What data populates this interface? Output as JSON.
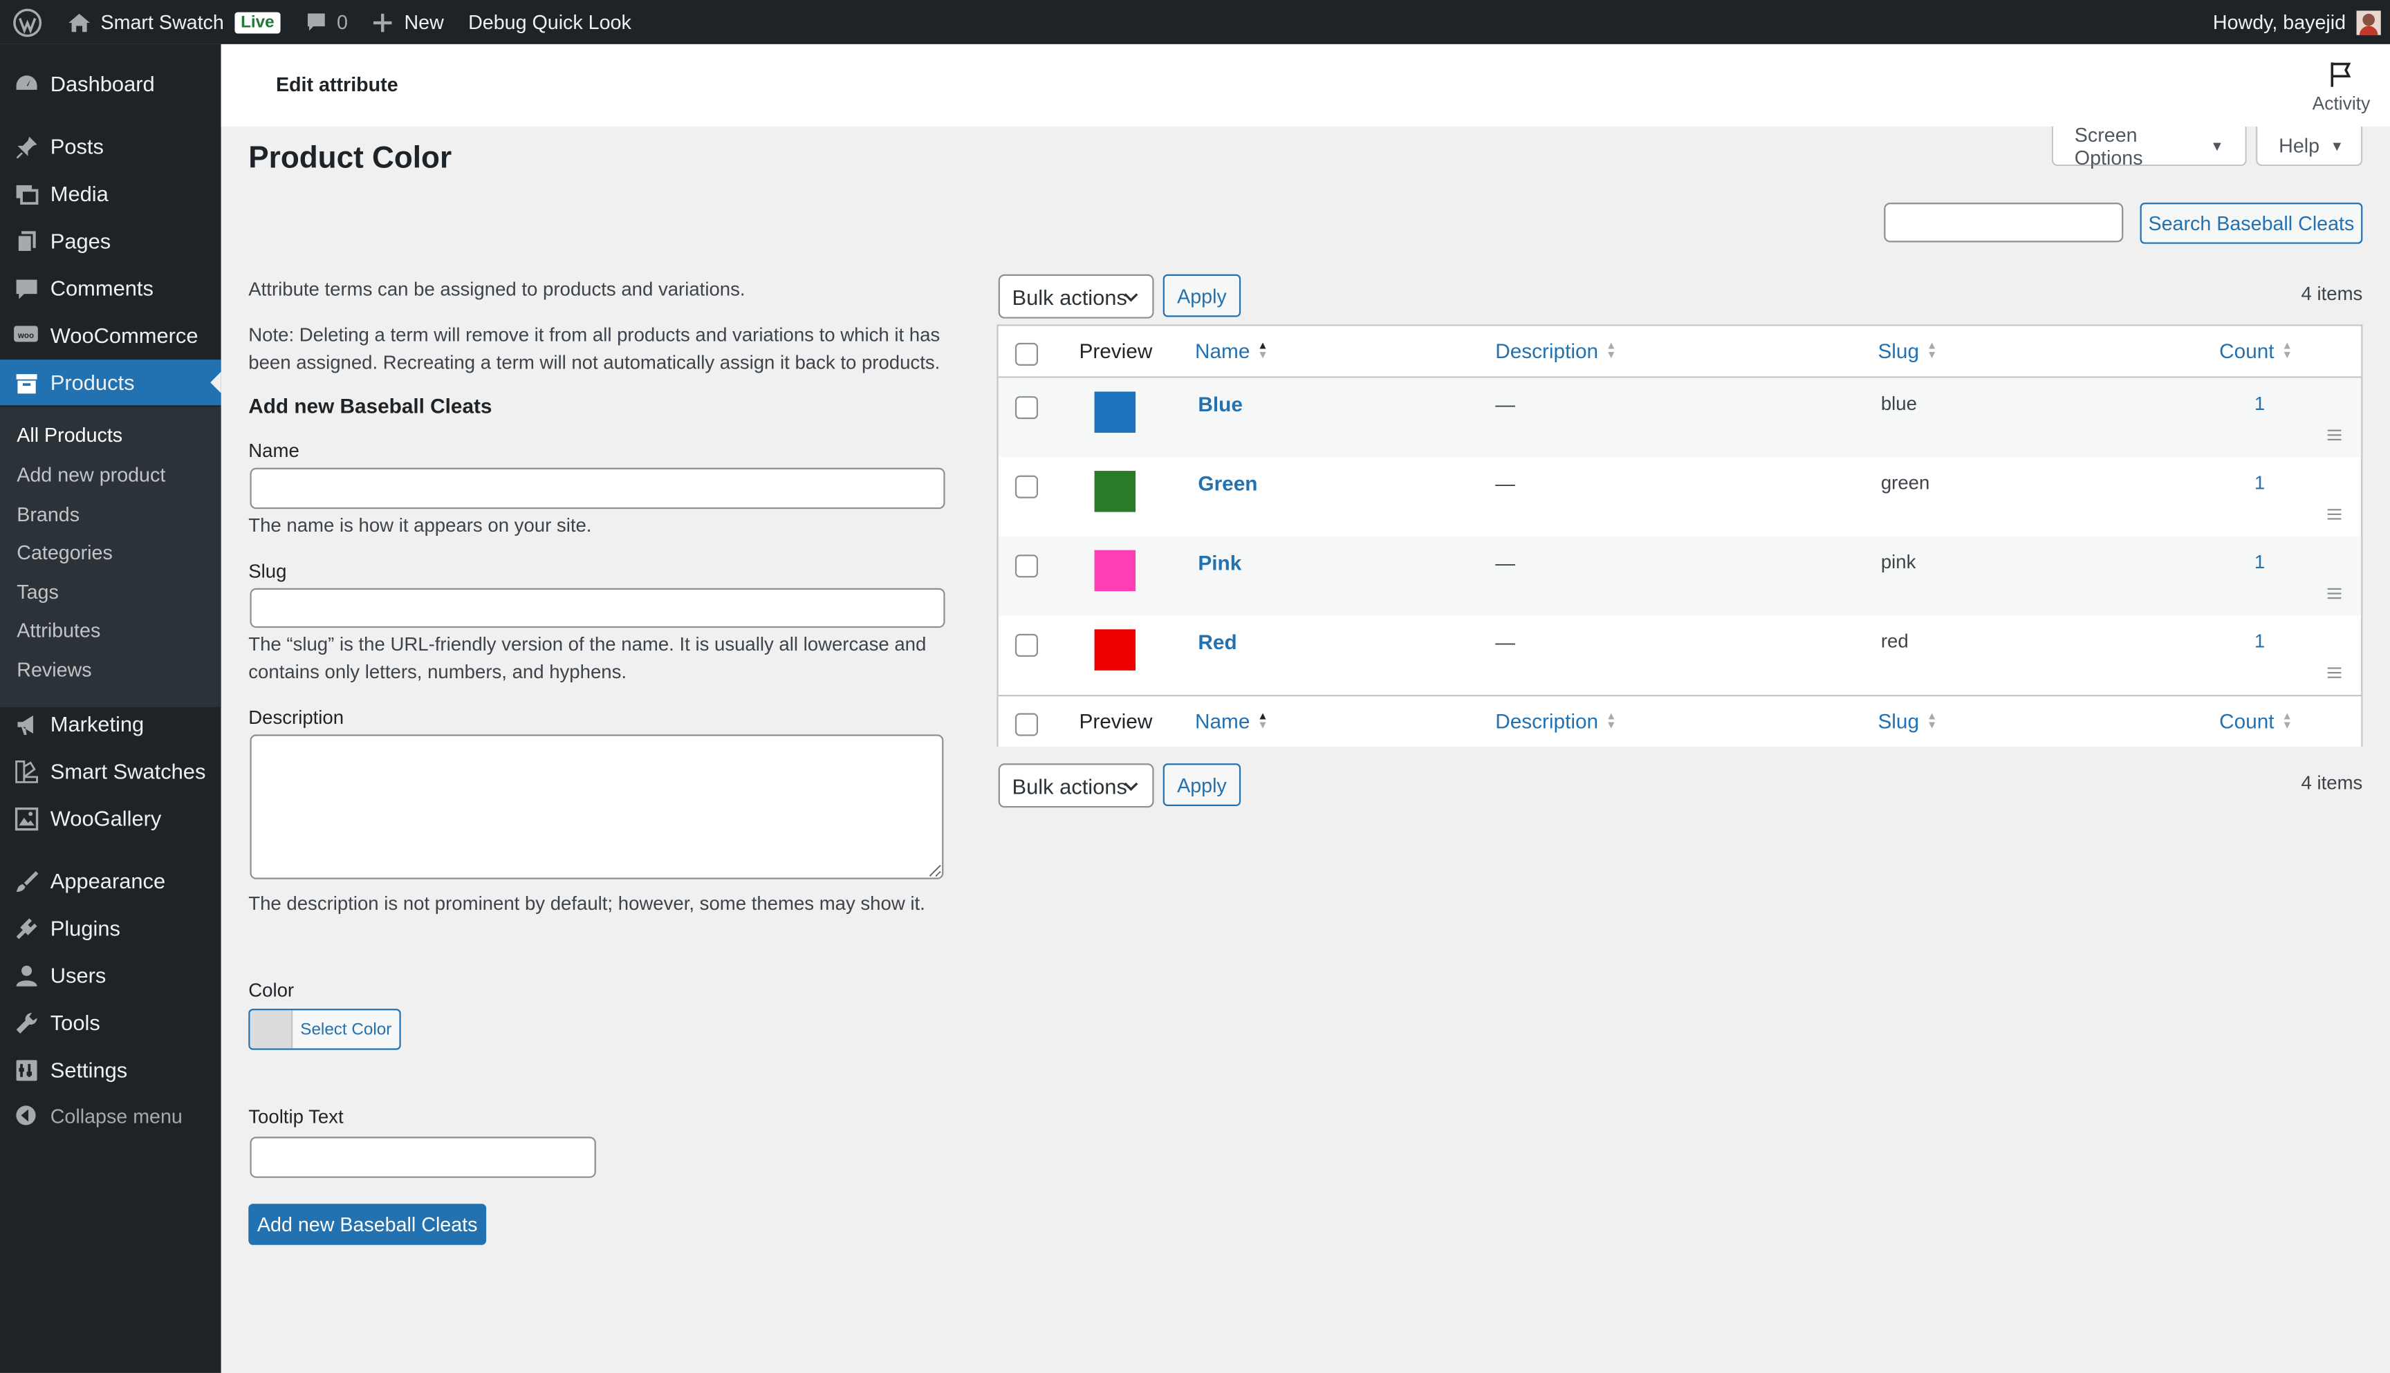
{
  "adminbar": {
    "site_name": "Smart Swatch",
    "live_badge": "Live",
    "comment_count": "0",
    "new_label": "New",
    "debug_label": "Debug Quick Look",
    "howdy": "Howdy, bayejid"
  },
  "sidebar": {
    "items": [
      {
        "label": "Dashboard",
        "icon": "dashboard-icon"
      },
      {
        "label": "Posts",
        "icon": "pin-icon"
      },
      {
        "label": "Media",
        "icon": "media-icon"
      },
      {
        "label": "Pages",
        "icon": "pages-icon"
      },
      {
        "label": "Comments",
        "icon": "comment-icon"
      },
      {
        "label": "WooCommerce",
        "icon": "woo-icon"
      },
      {
        "label": "Products",
        "icon": "archive-icon",
        "active": true
      },
      {
        "label": "Marketing",
        "icon": "megaphone-icon"
      },
      {
        "label": "Smart Swatches",
        "icon": "swatches-icon"
      },
      {
        "label": "WooGallery",
        "icon": "gallery-icon"
      },
      {
        "label": "Appearance",
        "icon": "brush-icon"
      },
      {
        "label": "Plugins",
        "icon": "plugin-icon"
      },
      {
        "label": "Users",
        "icon": "user-icon"
      },
      {
        "label": "Tools",
        "icon": "wrench-icon"
      },
      {
        "label": "Settings",
        "icon": "settings-icon"
      }
    ],
    "submenu": [
      "All Products",
      "Add new product",
      "Brands",
      "Categories",
      "Tags",
      "Attributes",
      "Reviews"
    ],
    "collapse_label": "Collapse menu"
  },
  "header": {
    "title": "Edit attribute",
    "activity_label": "Activity",
    "screen_options": "Screen Options",
    "help": "Help"
  },
  "page": {
    "title": "Product Color",
    "search_button": "Search Baseball Cleats"
  },
  "form": {
    "intro": "Attribute terms can be assigned to products and variations.",
    "note_line1": "Note: Deleting a term will remove it from all products and variations to which it has",
    "note_line2": "been assigned. Recreating a term will not automatically assign it back to products.",
    "heading": "Add new Baseball Cleats",
    "name_label": "Name",
    "name_help": "The name is how it appears on your site.",
    "slug_label": "Slug",
    "slug_help_line1": "The “slug” is the URL-friendly version of the name. It is usually all lowercase and",
    "slug_help_line2": "contains only letters, numbers, and hyphens.",
    "description_label": "Description",
    "description_help": "The description is not prominent by default; however, some themes may show it.",
    "color_label": "Color",
    "select_color": "Select Color",
    "tooltip_label": "Tooltip Text",
    "submit": "Add new Baseball Cleats"
  },
  "table": {
    "bulk_actions": "Bulk actions",
    "apply": "Apply",
    "items_count": "4 items",
    "columns": {
      "preview": "Preview",
      "name": "Name",
      "description": "Description",
      "slug": "Slug",
      "count": "Count"
    },
    "rows": [
      {
        "name": "Blue",
        "description": "—",
        "slug": "blue",
        "count": "1",
        "color": "#1e73be"
      },
      {
        "name": "Green",
        "description": "—",
        "slug": "green",
        "count": "1",
        "color": "#2a7a2a"
      },
      {
        "name": "Pink",
        "description": "—",
        "slug": "pink",
        "count": "1",
        "color": "#ff3fb4"
      },
      {
        "name": "Red",
        "description": "—",
        "slug": "red",
        "count": "1",
        "color": "#ee0000"
      }
    ]
  },
  "colors": {
    "accent": "#2271b1",
    "sidebar_bg": "#1d2327",
    "submenu_bg": "#2c3338"
  }
}
